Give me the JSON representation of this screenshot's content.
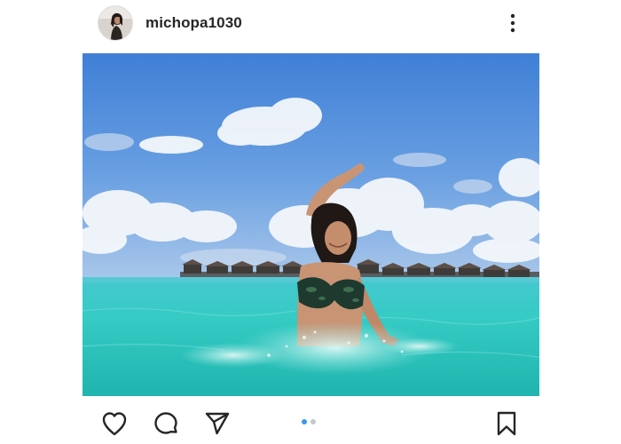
{
  "post": {
    "username": "michopa1030",
    "photo_alt": "",
    "carousel": {
      "total": 2,
      "active_index": 0
    }
  },
  "colors": {
    "carousel_active": "#3897f0",
    "carousel_inactive": "#c7c7c7",
    "icon": "#262626"
  },
  "icons": {
    "more": "more-vertical-icon",
    "like": "heart-icon",
    "comment": "comment-icon",
    "share": "send-icon",
    "save": "bookmark-icon"
  }
}
